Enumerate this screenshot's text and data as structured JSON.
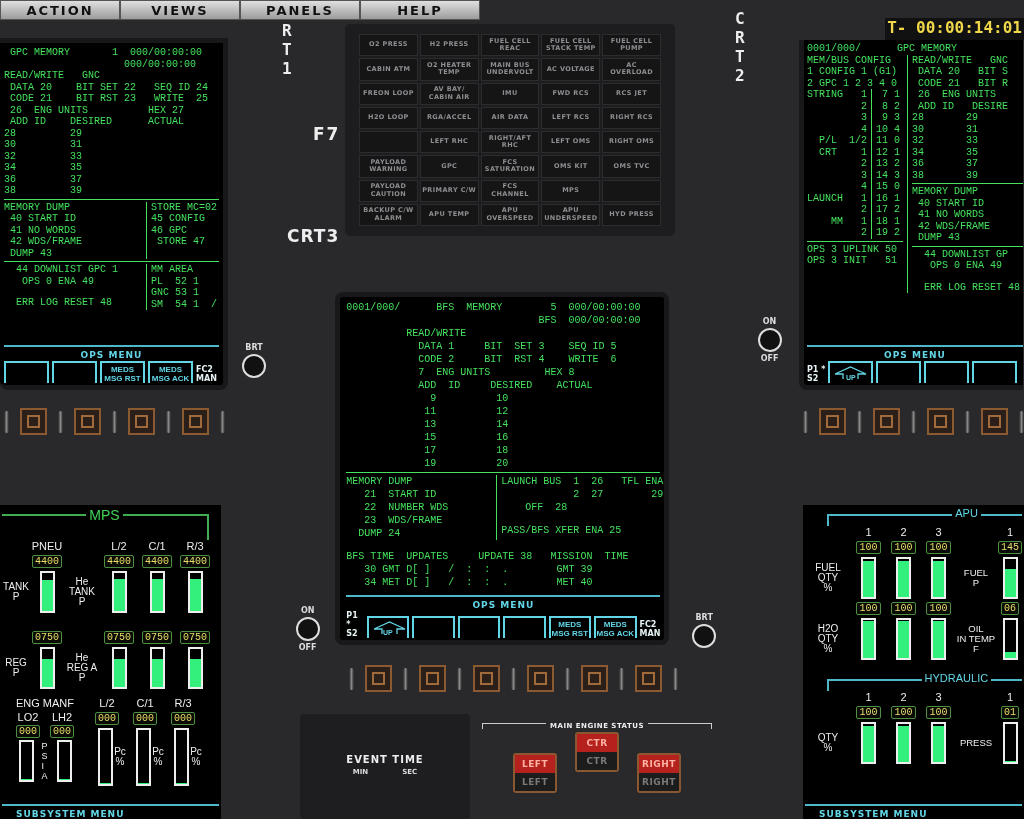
{
  "menu_bar": [
    "ACTION",
    "VIEWS",
    "PANELS",
    "HELP"
  ],
  "labels": {
    "crt1": "RT1",
    "f7": "F7",
    "crt3": "CRT3",
    "crt2": "CRT2"
  },
  "clock": "T-  00:00:14:01",
  "crt1": {
    "display": {
      "sections": [
        {
          "kind": "lines",
          "lines": [
            " GPC MEMORY       1  000/00:00:00",
            "                    000/00:00:00"
          ]
        },
        {
          "kind": "lines",
          "lines": [
            "READ/WRITE   GNC",
            " DATA 20    BIT SET 22   SEQ ID 24",
            " CODE 21    BIT RST 23   WRITE  25",
            " 26  ENG UNITS          HEX 27",
            " ADD ID    DESIRED      ACTUAL",
            "28         29",
            "30         31",
            "32         33",
            "34         35",
            "36         37",
            "38         39"
          ]
        },
        {
          "kind": "rule"
        },
        {
          "kind": "split",
          "left": [
            {
              "kind": "lines",
              "lines": [
                "MEMORY DUMP",
                " 40 START ID",
                " 41 NO WORDS",
                " 42 WDS/FRAME",
                " DUMP 43"
              ]
            }
          ],
          "right": [
            {
              "kind": "lines",
              "lines": [
                "STORE MC=02",
                "45 CONFIG",
                "46 GPC",
                " STORE 47"
              ]
            }
          ]
        },
        {
          "kind": "rule"
        },
        {
          "kind": "split",
          "left": [
            {
              "kind": "lines",
              "lines": [
                "  44 DOWNLIST GPC 1",
                "   OPS 0 ENA 49"
              ]
            },
            {
              "kind": "gap"
            },
            {
              "kind": "lines",
              "lines": [
                "  ERR LOG RESET 48"
              ]
            }
          ],
          "right": [
            {
              "kind": "lines",
              "lines": [
                "MM AREA",
                "PL  52 1",
                "GNC 53 1",
                "SM  54 1  /"
              ]
            }
          ]
        }
      ]
    },
    "softkeys": {
      "title": "OPS MENU",
      "keys": [
        {
          "kind": "blank"
        },
        {
          "kind": "blank"
        },
        {
          "kind": "label",
          "label": "MEDS\nMSG RST"
        },
        {
          "kind": "label",
          "label": "MEDS\nMSG ACK"
        }
      ],
      "suffix": "FC2\nMAN"
    },
    "knob": {
      "top": "BRT"
    }
  },
  "warning_panel": {
    "cells": [
      {
        "label": "O2 PRESS",
        "lit": false
      },
      {
        "label": "H2 PRESS",
        "lit": false
      },
      {
        "label": "FUEL CELL REAC",
        "lit": false
      },
      {
        "label": "FUEL CELL STACK TEMP",
        "lit": false
      },
      {
        "label": "FUEL CELL PUMP",
        "lit": false
      },
      {
        "label": "CABIN ATM",
        "lit": false
      },
      {
        "label": "O2 HEATER TEMP",
        "lit": false
      },
      {
        "label": "MAIN BUS UNDERVOLT",
        "lit": false
      },
      {
        "label": "AC VOLTAGE",
        "lit": false
      },
      {
        "label": "AC OVERLOAD",
        "lit": false
      },
      {
        "label": "FREON LOOP",
        "lit": false
      },
      {
        "label": "AV BAY/ CABIN AIR",
        "lit": false
      },
      {
        "label": "IMU",
        "lit": false
      },
      {
        "label": "FWD RCS",
        "lit": false
      },
      {
        "label": "RCS JET",
        "lit": false
      },
      {
        "label": "H2O LOOP",
        "lit": false
      },
      {
        "label": "RGA/ACCEL",
        "lit": false
      },
      {
        "label": "AIR DATA",
        "lit": false
      },
      {
        "label": "LEFT RCS",
        "lit": false
      },
      {
        "label": "RIGHT RCS",
        "lit": false
      },
      {
        "lit": false
      },
      {
        "label": "LEFT RHC",
        "lit": false
      },
      {
        "label": "RIGHT/AFT RHC",
        "lit": false
      },
      {
        "label": "LEFT OMS",
        "lit": false
      },
      {
        "label": "RIGHT OMS",
        "lit": false
      },
      {
        "label": "PAYLOAD WARNING",
        "lit": false
      },
      {
        "label": "GPC",
        "lit": false
      },
      {
        "label": "FCS SATURATION",
        "lit": false
      },
      {
        "label": "OMS KIT",
        "lit": false
      },
      {
        "label": "OMS TVC",
        "lit": false
      },
      {
        "label": "PAYLOAD CAUTION",
        "lit": false
      },
      {
        "label": "PRIMARY C/W",
        "lit": false
      },
      {
        "label": "FCS CHANNEL",
        "lit": false
      },
      {
        "label": "MPS",
        "lit": false
      },
      {
        "lit": false
      },
      {
        "label": "BACKUP C/W ALARM",
        "lit": false
      },
      {
        "label": "APU TEMP",
        "lit": false
      },
      {
        "label": "APU OVERSPEED",
        "lit": false
      },
      {
        "label": "APU UNDERSPEED",
        "lit": false
      },
      {
        "label": "HYD PRESS",
        "lit": false
      }
    ]
  },
  "crt3": {
    "display": {
      "sections": [
        {
          "kind": "lines",
          "lines": [
            "0001/000/      BFS  MEMORY        5  000/00:00:00",
            "                                BFS  000/00:00:00"
          ]
        },
        {
          "kind": "lines",
          "lines": [
            "          READ/WRITE",
            "            DATA 1     BIT  SET 3    SEQ ID 5",
            "            CODE 2     BIT  RST 4    WRITE  6",
            "            7  ENG UNITS         HEX 8",
            "            ADD  ID     DESIRED    ACTUAL",
            "              9          10",
            "             11          12",
            "             13          14",
            "             15          16",
            "             17          18",
            "             19          20"
          ]
        },
        {
          "kind": "rule"
        },
        {
          "kind": "split",
          "left": [
            {
              "kind": "lines",
              "lines": [
                "MEMORY DUMP",
                "   21  START ID",
                "   22  NUMBER WDS",
                "   23  WDS/FRAME",
                "  DUMP 24"
              ]
            }
          ],
          "right": [
            {
              "kind": "lines",
              "lines": [
                "LAUNCH BUS  1  26   TFL ENA",
                "            2  27        29",
                "    OFF  28"
              ]
            },
            {
              "kind": "gap"
            },
            {
              "kind": "lines",
              "lines": [
                "PASS/BFS XFER ENA 25"
              ]
            }
          ]
        },
        {
          "kind": "gap"
        },
        {
          "kind": "lines",
          "lines": [
            "BFS TIME  UPDATES     UPDATE 38   MISSION  TIME",
            "   30 GMT D[ ]   /  :  :  .        GMT 39",
            "   34 MET D[ ]   /  :  :  .        MET 40"
          ]
        }
      ]
    },
    "softkeys": {
      "title": "OPS MENU",
      "prefix": "P1 *\nS2",
      "keys": [
        {
          "kind": "up",
          "label": "UP"
        },
        {
          "kind": "blank"
        },
        {
          "kind": "blank"
        },
        {
          "kind": "blank"
        },
        {
          "kind": "label",
          "label": "MEDS\nMSG RST"
        },
        {
          "kind": "label",
          "label": "MEDS\nMSG ACK"
        }
      ],
      "suffix": "FC2\nMAN"
    },
    "knob_left": {
      "top": "ON",
      "bottom": "OFF"
    },
    "knob_right": {
      "top": "BRT"
    }
  },
  "crt2": {
    "display": {
      "sections": [
        {
          "kind": "lines",
          "lines": [
            "0001/000/      GPC MEMORY"
          ]
        },
        {
          "kind": "split",
          "left": [
            {
              "kind": "lines",
              "lines": [
                "MEM/BUS CONFIG",
                "1 CONFIG 1 (G1)",
                "2 GPC 1 2 3 4 0"
              ]
            },
            {
              "kind": "split",
              "left": [
                {
                  "kind": "lines",
                  "lines": [
                    "STRING   1",
                    "         2",
                    "         3",
                    "         4",
                    "  P/L  1/2",
                    "  CRT    1",
                    "         2",
                    "         3",
                    "         4",
                    "LAUNCH   1",
                    "         2",
                    "    MM   1",
                    "         2"
                  ]
                }
              ],
              "right": [
                {
                  "kind": "lines",
                  "lines": [
                    " 7 1",
                    " 8 2",
                    " 9 3",
                    "10 4",
                    "11 0",
                    "12 1",
                    "13 2",
                    "14 3",
                    "15 0",
                    "16 1",
                    "17 2",
                    "18 1",
                    "19 2"
                  ]
                }
              ]
            },
            {
              "kind": "rule"
            },
            {
              "kind": "lines",
              "lines": [
                "OPS 3 UPLINK 50",
                "OPS 3 INIT   51"
              ]
            }
          ],
          "right": [
            {
              "kind": "lines",
              "lines": [
                "READ/WRITE   GNC",
                " DATA 20   BIT S",
                " CODE 21   BIT R",
                " 26  ENG UNITS",
                " ADD ID   DESIRE",
                "28       29",
                "30       31",
                "32       33",
                "34       35",
                "36       37",
                "38       39"
              ]
            },
            {
              "kind": "rule"
            },
            {
              "kind": "lines",
              "lines": [
                "MEMORY DUMP",
                " 40 START ID",
                " 41 NO WORDS",
                " 42 WDS/FRAME",
                " DUMP 43"
              ]
            },
            {
              "kind": "rule"
            },
            {
              "kind": "lines",
              "lines": [
                "  44 DOWNLIST GP",
                "   OPS 0 ENA 49"
              ]
            },
            {
              "kind": "gap"
            },
            {
              "kind": "lines",
              "lines": [
                "  ERR LOG RESET 48"
              ]
            }
          ]
        }
      ]
    },
    "softkeys": {
      "title": "OPS MENU",
      "prefix": "P1 *\nS2",
      "keys": [
        {
          "kind": "up",
          "label": "UP"
        },
        {
          "kind": "blank"
        },
        {
          "kind": "blank"
        },
        {
          "kind": "blank"
        }
      ]
    },
    "knob": {
      "top": "ON",
      "bottom": "OFF"
    }
  },
  "event_timer": {
    "title": "EVENT TIME",
    "units": [
      "MIN",
      "SEC"
    ]
  },
  "engine_status": {
    "title": "MAIN ENGINE STATUS",
    "lights": [
      {
        "top": {
          "label": "LEFT",
          "lit": true
        },
        "bottom": {
          "label": "LEFT",
          "lit": false
        }
      },
      {
        "top": {
          "label": "CTR",
          "lit": true
        },
        "bottom": {
          "label": "CTR",
          "lit": false
        }
      },
      {
        "top": {
          "label": "RIGHT",
          "lit": true
        },
        "bottom": {
          "label": "RIGHT",
          "lit": false
        }
      }
    ]
  },
  "mps": {
    "title": "MPS",
    "pneu": {
      "label": "PNEU",
      "tank_label": "TANK\nP",
      "reg_label": "REG\nP",
      "tank": {
        "reading": "4400",
        "level": 0.82
      },
      "reg": {
        "reading": "0750",
        "level": 0.75
      }
    },
    "he": {
      "tank_label": "He\nTANK\nP",
      "reg_label": "He\nREG A\nP",
      "engines": [
        {
          "label": "L/2",
          "tank": {
            "reading": "4400",
            "level": 0.85
          },
          "reg": {
            "reading": "0750",
            "level": 0.75
          }
        },
        {
          "label": "C/1",
          "tank": {
            "reading": "4400",
            "level": 0.85
          },
          "reg": {
            "reading": "0750",
            "level": 0.75
          }
        },
        {
          "label": "R/3",
          "tank": {
            "reading": "4400",
            "level": 0.85
          },
          "reg": {
            "reading": "0750",
            "level": 0.75
          }
        }
      ]
    },
    "eng_manf": {
      "title": "ENG MANF",
      "unit": "PSIA",
      "lines": [
        {
          "label": "LO2",
          "reading": "000",
          "level": 0
        },
        {
          "label": "LH2",
          "reading": "000",
          "level": 0
        }
      ]
    },
    "pc": [
      {
        "label": "L/2",
        "reading": "000",
        "level": 0,
        "unit": "Pc\n%"
      },
      {
        "label": "C/1",
        "reading": "000",
        "level": 0,
        "unit": "Pc\n%"
      },
      {
        "label": "R/3",
        "reading": "000",
        "level": 0,
        "unit": "Pc\n%"
      }
    ],
    "menu": "SUBSYSTEM MENU"
  },
  "apu_hyd": {
    "sections": [
      {
        "title": "APU",
        "headers": [
          "1",
          "2",
          "3"
        ],
        "rows": [
          {
            "label": "FUEL\nQTY\n%",
            "gauges": [
              {
                "reading": "100",
                "level": 0.95
              },
              {
                "reading": "100",
                "level": 0.95
              },
              {
                "reading": "100",
                "level": 0.95
              }
            ]
          },
          {
            "label": "H2O\nQTY\n%",
            "gauges": [
              {
                "reading": "100",
                "level": 0.97
              },
              {
                "reading": "100",
                "level": 0.97
              },
              {
                "reading": "100",
                "level": 0.97
              }
            ]
          }
        ],
        "side": {
          "header": "1",
          "rows": [
            {
              "label": "FUEL\nP",
              "reading": "145",
              "level": 0.75
            },
            {
              "label": "OIL\nIN TEMP\nF",
              "reading": "06",
              "level": 0.15
            }
          ]
        }
      },
      {
        "title": "HYDRAULIC",
        "headers": [
          "1",
          "2",
          "3"
        ],
        "rows": [
          {
            "label": "QTY\n%",
            "gauges": [
              {
                "reading": "100",
                "level": 0.95
              },
              {
                "reading": "100",
                "level": 0.95
              },
              {
                "reading": "100",
                "level": 0.95
              }
            ]
          }
        ],
        "side": {
          "header": "1",
          "rows": [
            {
              "label": "PRESS",
              "reading": "01",
              "level": 0
            }
          ]
        }
      }
    ],
    "menu": "SUBSYSTEM MENU"
  }
}
